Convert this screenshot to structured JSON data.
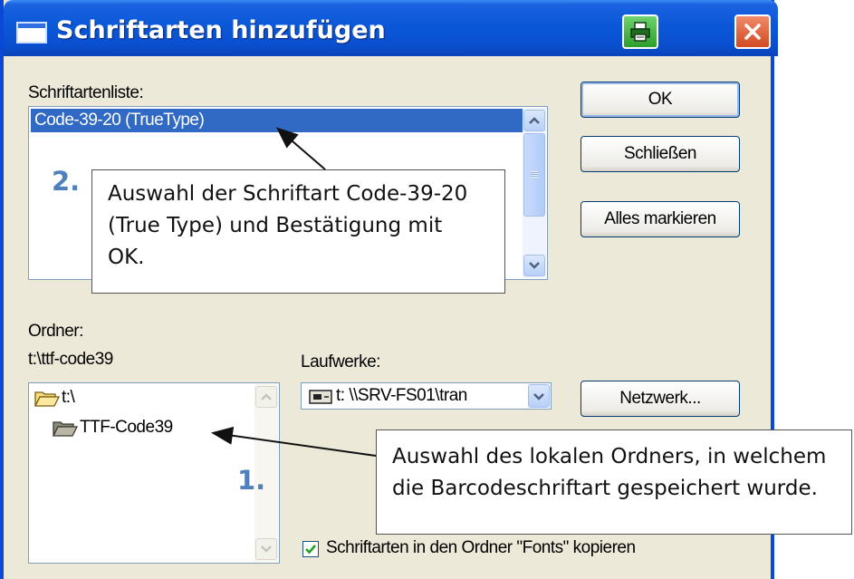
{
  "window": {
    "title": "Schriftarten hinzufügen",
    "title_icon": "window-icon",
    "print_icon": "printer-icon",
    "close_icon": "close-icon"
  },
  "font_list": {
    "label": "Schriftartenliste:",
    "selected_item": "Code-39-20 (TrueType)"
  },
  "buttons": {
    "ok": "OK",
    "close": "Schließen",
    "select_all": "Alles markieren",
    "network": "Netzwerk..."
  },
  "folder": {
    "label": "Ordner:",
    "path": "t:\\ttf-code39",
    "items": [
      {
        "name": "t:\\",
        "icon": "open-folder-icon"
      },
      {
        "name": "TTF-Code39",
        "icon": "open-folder-icon"
      }
    ]
  },
  "drives": {
    "label": "Laufwerke:",
    "value": "t: \\\\SRV-FS01\\tran",
    "icon": "network-drive-icon"
  },
  "copy_option": {
    "label": "Schriftarten in den Ordner \"Fonts\" kopieren",
    "checked": true
  },
  "annotations": {
    "step2_number": "2.",
    "step2_text_line1": "Auswahl der Schriftart Code-39-20",
    "step2_text_line2": "(True Type) und Bestätigung mit",
    "step2_text_line3": "OK.",
    "step1_number": "1.",
    "step1_text_line1": "Auswahl des lokalen Ordners, in welchem",
    "step1_text_line2": "die Barcodeschriftart gespeichert wurde."
  },
  "colors": {
    "titlebar": "#0a58d8",
    "selection": "#316ac5",
    "step_number": "#4f81bd",
    "dialog_background": "#ece9d8"
  }
}
